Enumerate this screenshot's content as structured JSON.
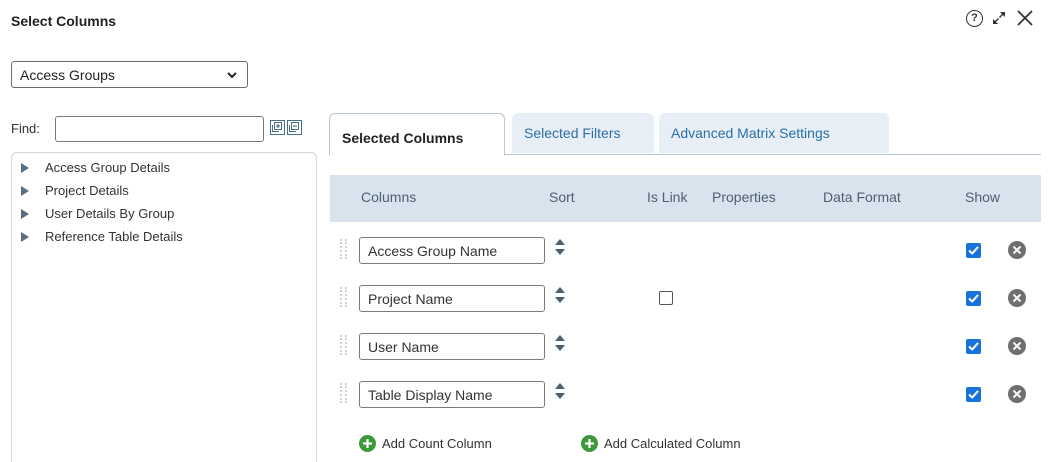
{
  "window": {
    "title": "Select Columns",
    "help_glyph": "?"
  },
  "icons": {
    "help": "help-circle-icon",
    "expand": "expand-icon",
    "close": "close-icon"
  },
  "group_select": {
    "value": "Access Groups"
  },
  "find": {
    "label": "Find:",
    "value": "",
    "expand_all": "expand-all-icon",
    "collapse_all": "collapse-all-icon"
  },
  "tree": {
    "items": [
      {
        "label": "Access Group Details"
      },
      {
        "label": "Project Details"
      },
      {
        "label": "User Details By Group"
      },
      {
        "label": "Reference Table Details"
      }
    ]
  },
  "tabs": [
    {
      "label": "Selected Columns",
      "active": true
    },
    {
      "label": "Selected Filters",
      "active": false
    },
    {
      "label": "Advanced Matrix Settings",
      "active": false
    }
  ],
  "table": {
    "headers": {
      "columns": "Columns",
      "sort": "Sort",
      "is_link": "Is Link",
      "properties": "Properties",
      "data_format": "Data Format",
      "show": "Show"
    },
    "rows": [
      {
        "column": "Access Group Name",
        "has_link_option": false,
        "show": true
      },
      {
        "column": "Project Name",
        "has_link_option": true,
        "is_link": false,
        "show": true
      },
      {
        "column": "User Name",
        "has_link_option": false,
        "show": true
      },
      {
        "column": "Table Display Name",
        "has_link_option": false,
        "show": true
      }
    ]
  },
  "actions": {
    "add_count": "Add Count Column",
    "add_calculated": "Add Calculated Column"
  },
  "colors": {
    "accent": "#1a73d9",
    "tab_text": "#2a6fa8",
    "header_bg": "#d9e3ed",
    "add_green": "#3d9a3b",
    "remove_gray": "#6f6f6f"
  }
}
